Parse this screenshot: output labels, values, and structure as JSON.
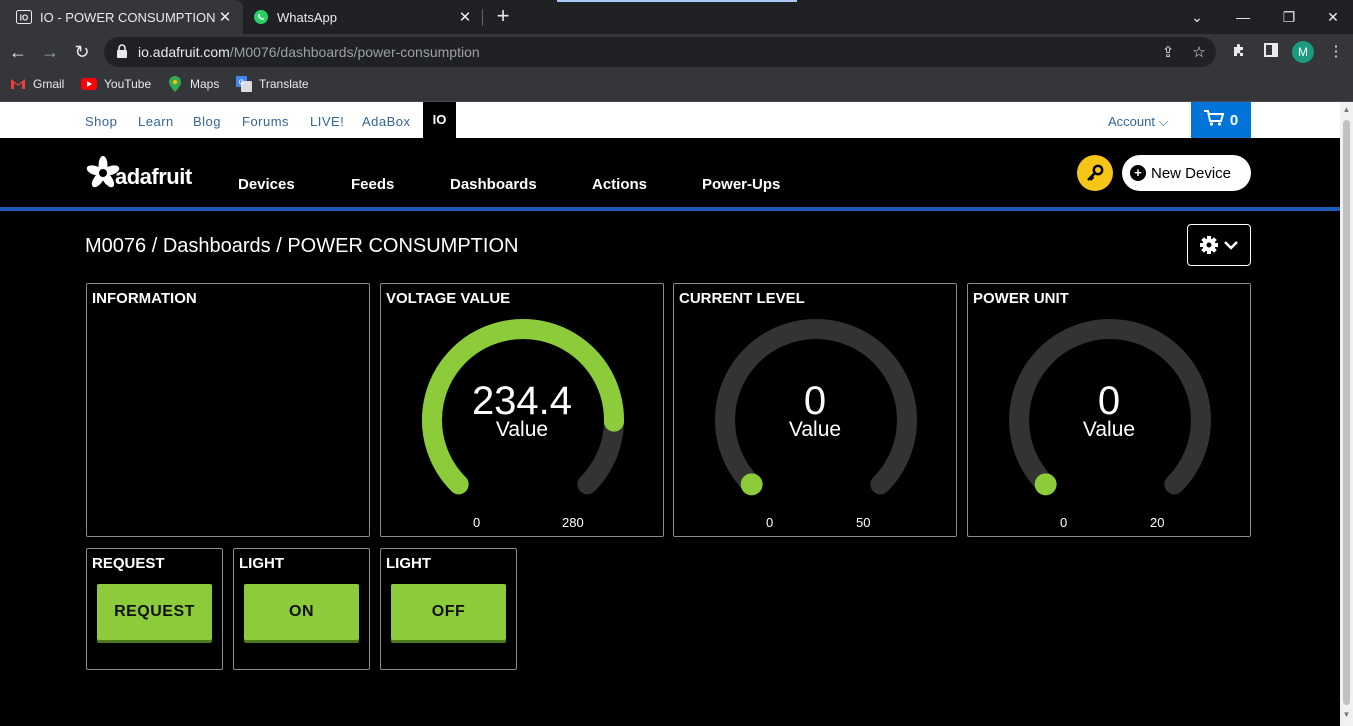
{
  "browser": {
    "tabs": [
      {
        "title": "IO - POWER CONSUMPTION",
        "icon": "adafruit-io-favicon"
      },
      {
        "title": "WhatsApp",
        "icon": "whatsapp-icon"
      }
    ],
    "url_host": "io.adafruit.com",
    "url_path": "/M0076/dashboards/power-consumption",
    "profile_initial": "M",
    "bookmarks": [
      {
        "label": "Gmail",
        "icon": "gmail-icon"
      },
      {
        "label": "YouTube",
        "icon": "youtube-icon"
      },
      {
        "label": "Maps",
        "icon": "maps-icon"
      },
      {
        "label": "Translate",
        "icon": "translate-icon"
      }
    ]
  },
  "site_nav": {
    "links": [
      "Shop",
      "Learn",
      "Blog",
      "Forums",
      "LIVE!",
      "AdaBox"
    ],
    "io_label": "IO",
    "account_label": "Account",
    "cart_count": "0"
  },
  "header": {
    "logo_text": "adafruit",
    "nav": [
      "Devices",
      "Feeds",
      "Dashboards",
      "Actions",
      "Power-Ups"
    ],
    "new_device_label": "New Device"
  },
  "breadcrumb": "M0076 / Dashboards / POWER CONSUMPTION",
  "blocks": {
    "information": {
      "title": "INFORMATION"
    },
    "gauges": [
      {
        "title": "VOLTAGE VALUE",
        "value": "234.4",
        "value_num": 234.4,
        "label": "Value",
        "min": "0",
        "max": "280",
        "min_num": 0,
        "max_num": 280
      },
      {
        "title": "CURRENT LEVEL",
        "value": "0",
        "value_num": 0,
        "label": "Value",
        "min": "0",
        "max": "50",
        "min_num": 0,
        "max_num": 50
      },
      {
        "title": "POWER UNIT",
        "value": "0",
        "value_num": 0,
        "label": "Value",
        "min": "0",
        "max": "20",
        "min_num": 0,
        "max_num": 20
      }
    ],
    "buttons": [
      {
        "title": "REQUEST",
        "label": "REQUEST"
      },
      {
        "title": "LIGHT",
        "label": "ON"
      },
      {
        "title": "LIGHT",
        "label": "OFF"
      }
    ]
  },
  "colors": {
    "gauge_fill": "#8ccb3a",
    "gauge_track": "#333333",
    "cart_bg": "#0074d9",
    "header_rule": "#1c5ab8",
    "key_button": "#f5c518"
  }
}
